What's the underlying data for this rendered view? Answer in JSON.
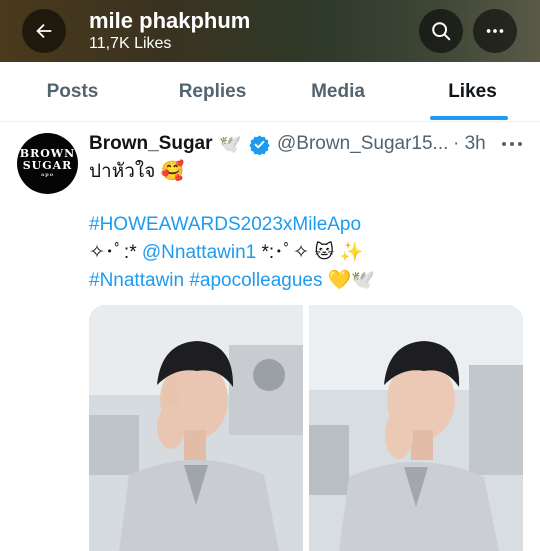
{
  "header": {
    "title": "mile phakphum",
    "subtitle": "11,7K Likes",
    "gradient_colors": [
      "#4a3a1c",
      "#2e3a2a",
      "#5a5a48"
    ]
  },
  "tabs": [
    {
      "label": "Posts",
      "active": false
    },
    {
      "label": "Replies",
      "active": false
    },
    {
      "label": "Media",
      "active": false
    },
    {
      "label": "Likes",
      "active": true
    }
  ],
  "tweet": {
    "avatar_text": [
      "BROWN",
      "SUGAR",
      "apo"
    ],
    "display_name": "Brown_Sugar",
    "name_emoji": "🕊️",
    "handle": "@Brown_Sugar15...",
    "time": "· 3h",
    "text_line1": "ปาหัวใจ 🥰",
    "hashtag_line": "#HOWEAWARDS2023xMileApo",
    "mention_prefix": "✧･ﾟ:* ",
    "mention": "@Nnattawin1",
    "mention_suffix": " *:･ﾟ✧ 🐱 ✨",
    "hashtag_a": "#Nnattawin",
    "hashtag_b": "#apocolleagues",
    "hashtag_suffix": " 💛🕊️",
    "photos": [
      "photo-left",
      "photo-right"
    ]
  },
  "colors": {
    "accent": "#1d9bf0",
    "text": "#0f1419",
    "muted": "#536471"
  },
  "icons": [
    "back-arrow-icon",
    "search-icon",
    "more-icon",
    "verified-badge-icon",
    "ellipsis-icon"
  ]
}
